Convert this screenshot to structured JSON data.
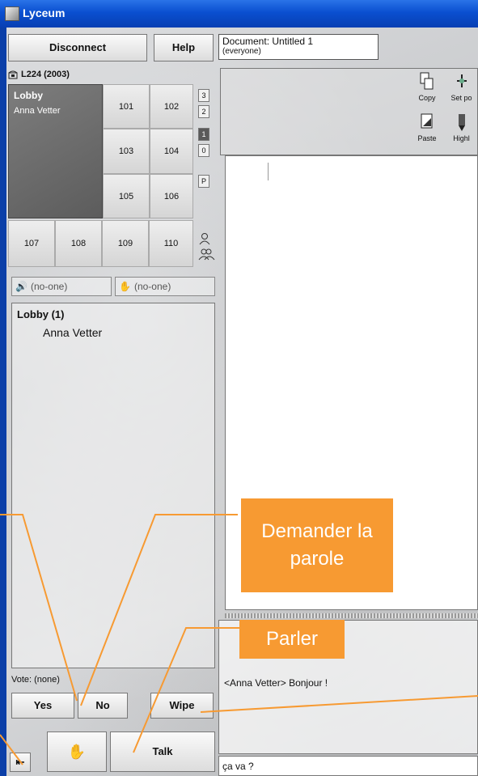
{
  "window": {
    "title": "Lyceum"
  },
  "toolbar": {
    "disconnect_label": "Disconnect",
    "help_label": "Help",
    "document_line1": "Document: Untitled 1",
    "document_line2": "(everyone)"
  },
  "building": {
    "header": "L224 (2003)",
    "lobby": {
      "label": "Lobby",
      "user": "Anna Vetter"
    },
    "rooms": [
      "101",
      "102",
      "103",
      "104",
      "105",
      "106",
      "107",
      "108",
      "109",
      "110"
    ],
    "floors": [
      "3",
      "2",
      "1",
      "0",
      "P"
    ],
    "active_floor": "1"
  },
  "audio": {
    "speaker_label": "(no-one)",
    "hand_label": "(no-one)"
  },
  "participants": {
    "room_title": "Lobby (1)",
    "users": [
      "Anna Vetter"
    ]
  },
  "vote": {
    "label": "Vote: (none)",
    "yes_label": "Yes",
    "no_label": "No"
  },
  "chat": {
    "wipe_label": "Wipe",
    "talk_label": "Talk",
    "message_sender": "<Anna Vetter>",
    "message_text": "Bonjour !",
    "input_value": "ça va ?"
  },
  "doc_tools": {
    "copy": "Copy",
    "set_pointer": "Set po",
    "paste": "Paste",
    "highlight": "Highl"
  },
  "callouts": {
    "request": "Demander la parole",
    "talk": "Parler"
  },
  "colors": {
    "callout": "#f79a32",
    "titlebar": "#0a4fd0"
  }
}
